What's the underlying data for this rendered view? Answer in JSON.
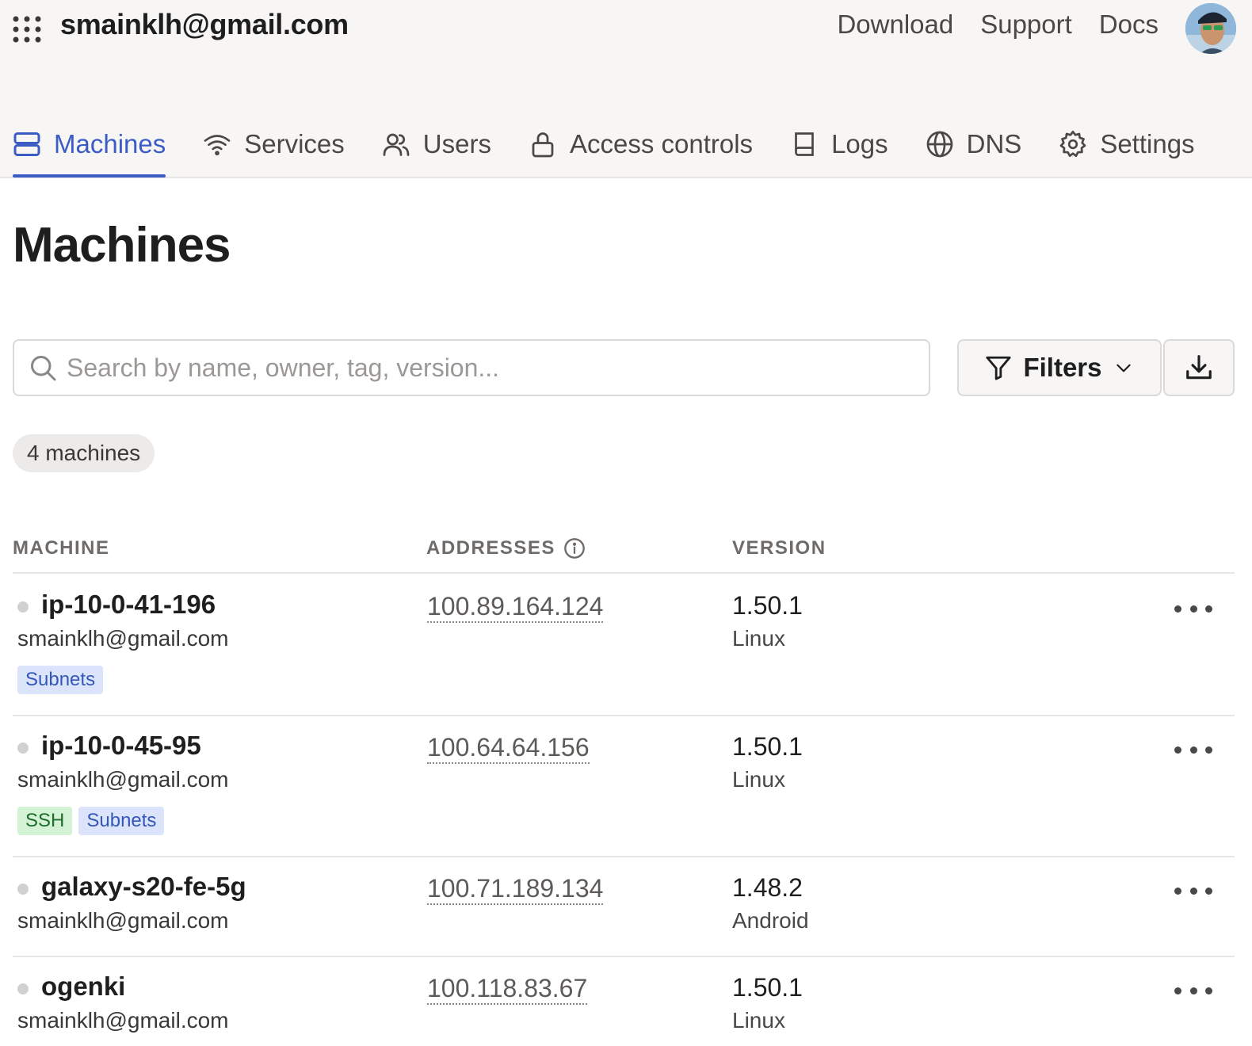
{
  "account": "smainklh@gmail.com",
  "top_links": [
    "Download",
    "Support",
    "Docs"
  ],
  "tabs": [
    {
      "label": "Machines",
      "icon": "server-icon",
      "active": true
    },
    {
      "label": "Services",
      "icon": "wifi-icon",
      "active": false
    },
    {
      "label": "Users",
      "icon": "users-icon",
      "active": false
    },
    {
      "label": "Access controls",
      "icon": "lock-icon",
      "active": false
    },
    {
      "label": "Logs",
      "icon": "book-icon",
      "active": false
    },
    {
      "label": "DNS",
      "icon": "globe-icon",
      "active": false
    },
    {
      "label": "Settings",
      "icon": "gear-icon",
      "active": false
    }
  ],
  "page_title": "Machines",
  "search": {
    "placeholder": "Search by name, owner, tag, version..."
  },
  "filters_label": "Filters",
  "machine_count": "4 machines",
  "table": {
    "headers": {
      "machine": "MACHINE",
      "addresses": "ADDRESSES",
      "version": "VERSION"
    },
    "rows": [
      {
        "name": "ip-10-0-41-196",
        "owner": "smainklh@gmail.com",
        "tags": [
          "Subnets"
        ],
        "address": "100.89.164.124",
        "version": "1.50.1",
        "os": "Linux"
      },
      {
        "name": "ip-10-0-45-95",
        "owner": "smainklh@gmail.com",
        "tags": [
          "SSH",
          "Subnets"
        ],
        "address": "100.64.64.156",
        "version": "1.50.1",
        "os": "Linux"
      },
      {
        "name": "galaxy-s20-fe-5g",
        "owner": "smainklh@gmail.com",
        "tags": [],
        "address": "100.71.189.134",
        "version": "1.48.2",
        "os": "Android"
      },
      {
        "name": "ogenki",
        "owner": "smainklh@gmail.com",
        "tags": [],
        "address": "100.118.83.67",
        "version": "1.50.1",
        "os": "Linux"
      }
    ]
  },
  "colors": {
    "accent": "#3c5cc5",
    "header_bg": "#f7f6f5",
    "tag_blue": "#dbe4fa",
    "tag_green": "#d4f3d6"
  }
}
